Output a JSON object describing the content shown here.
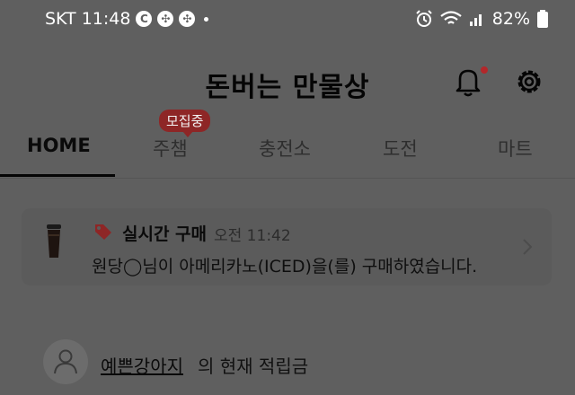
{
  "status_bar": {
    "carrier_time": "SKT 11:48",
    "icons": [
      "c-icon",
      "pinwheel-icon",
      "pinwheel-icon",
      "dot"
    ],
    "right_icons": [
      "alarm-icon",
      "wifi-icon",
      "signal-icon"
    ],
    "battery": "82%"
  },
  "header": {
    "title": "돈버는 만물상",
    "notification_has_badge": true
  },
  "tabs": {
    "items": [
      "HOME",
      "주챔",
      "충전소",
      "도전",
      "마트"
    ],
    "active": "HOME",
    "badge": "모집중"
  },
  "realtime": {
    "title": "실시간 구매",
    "time": "오전 11:42",
    "message": "원당◯님이 아메리카노(ICED)을(를) 구매하였습니다."
  },
  "points": {
    "nickname": "예쁜강아지",
    "suffix": "의 현재 적립금"
  },
  "colors": {
    "accent": "#8e2626",
    "overlay_bg": "#5f5f5f"
  }
}
